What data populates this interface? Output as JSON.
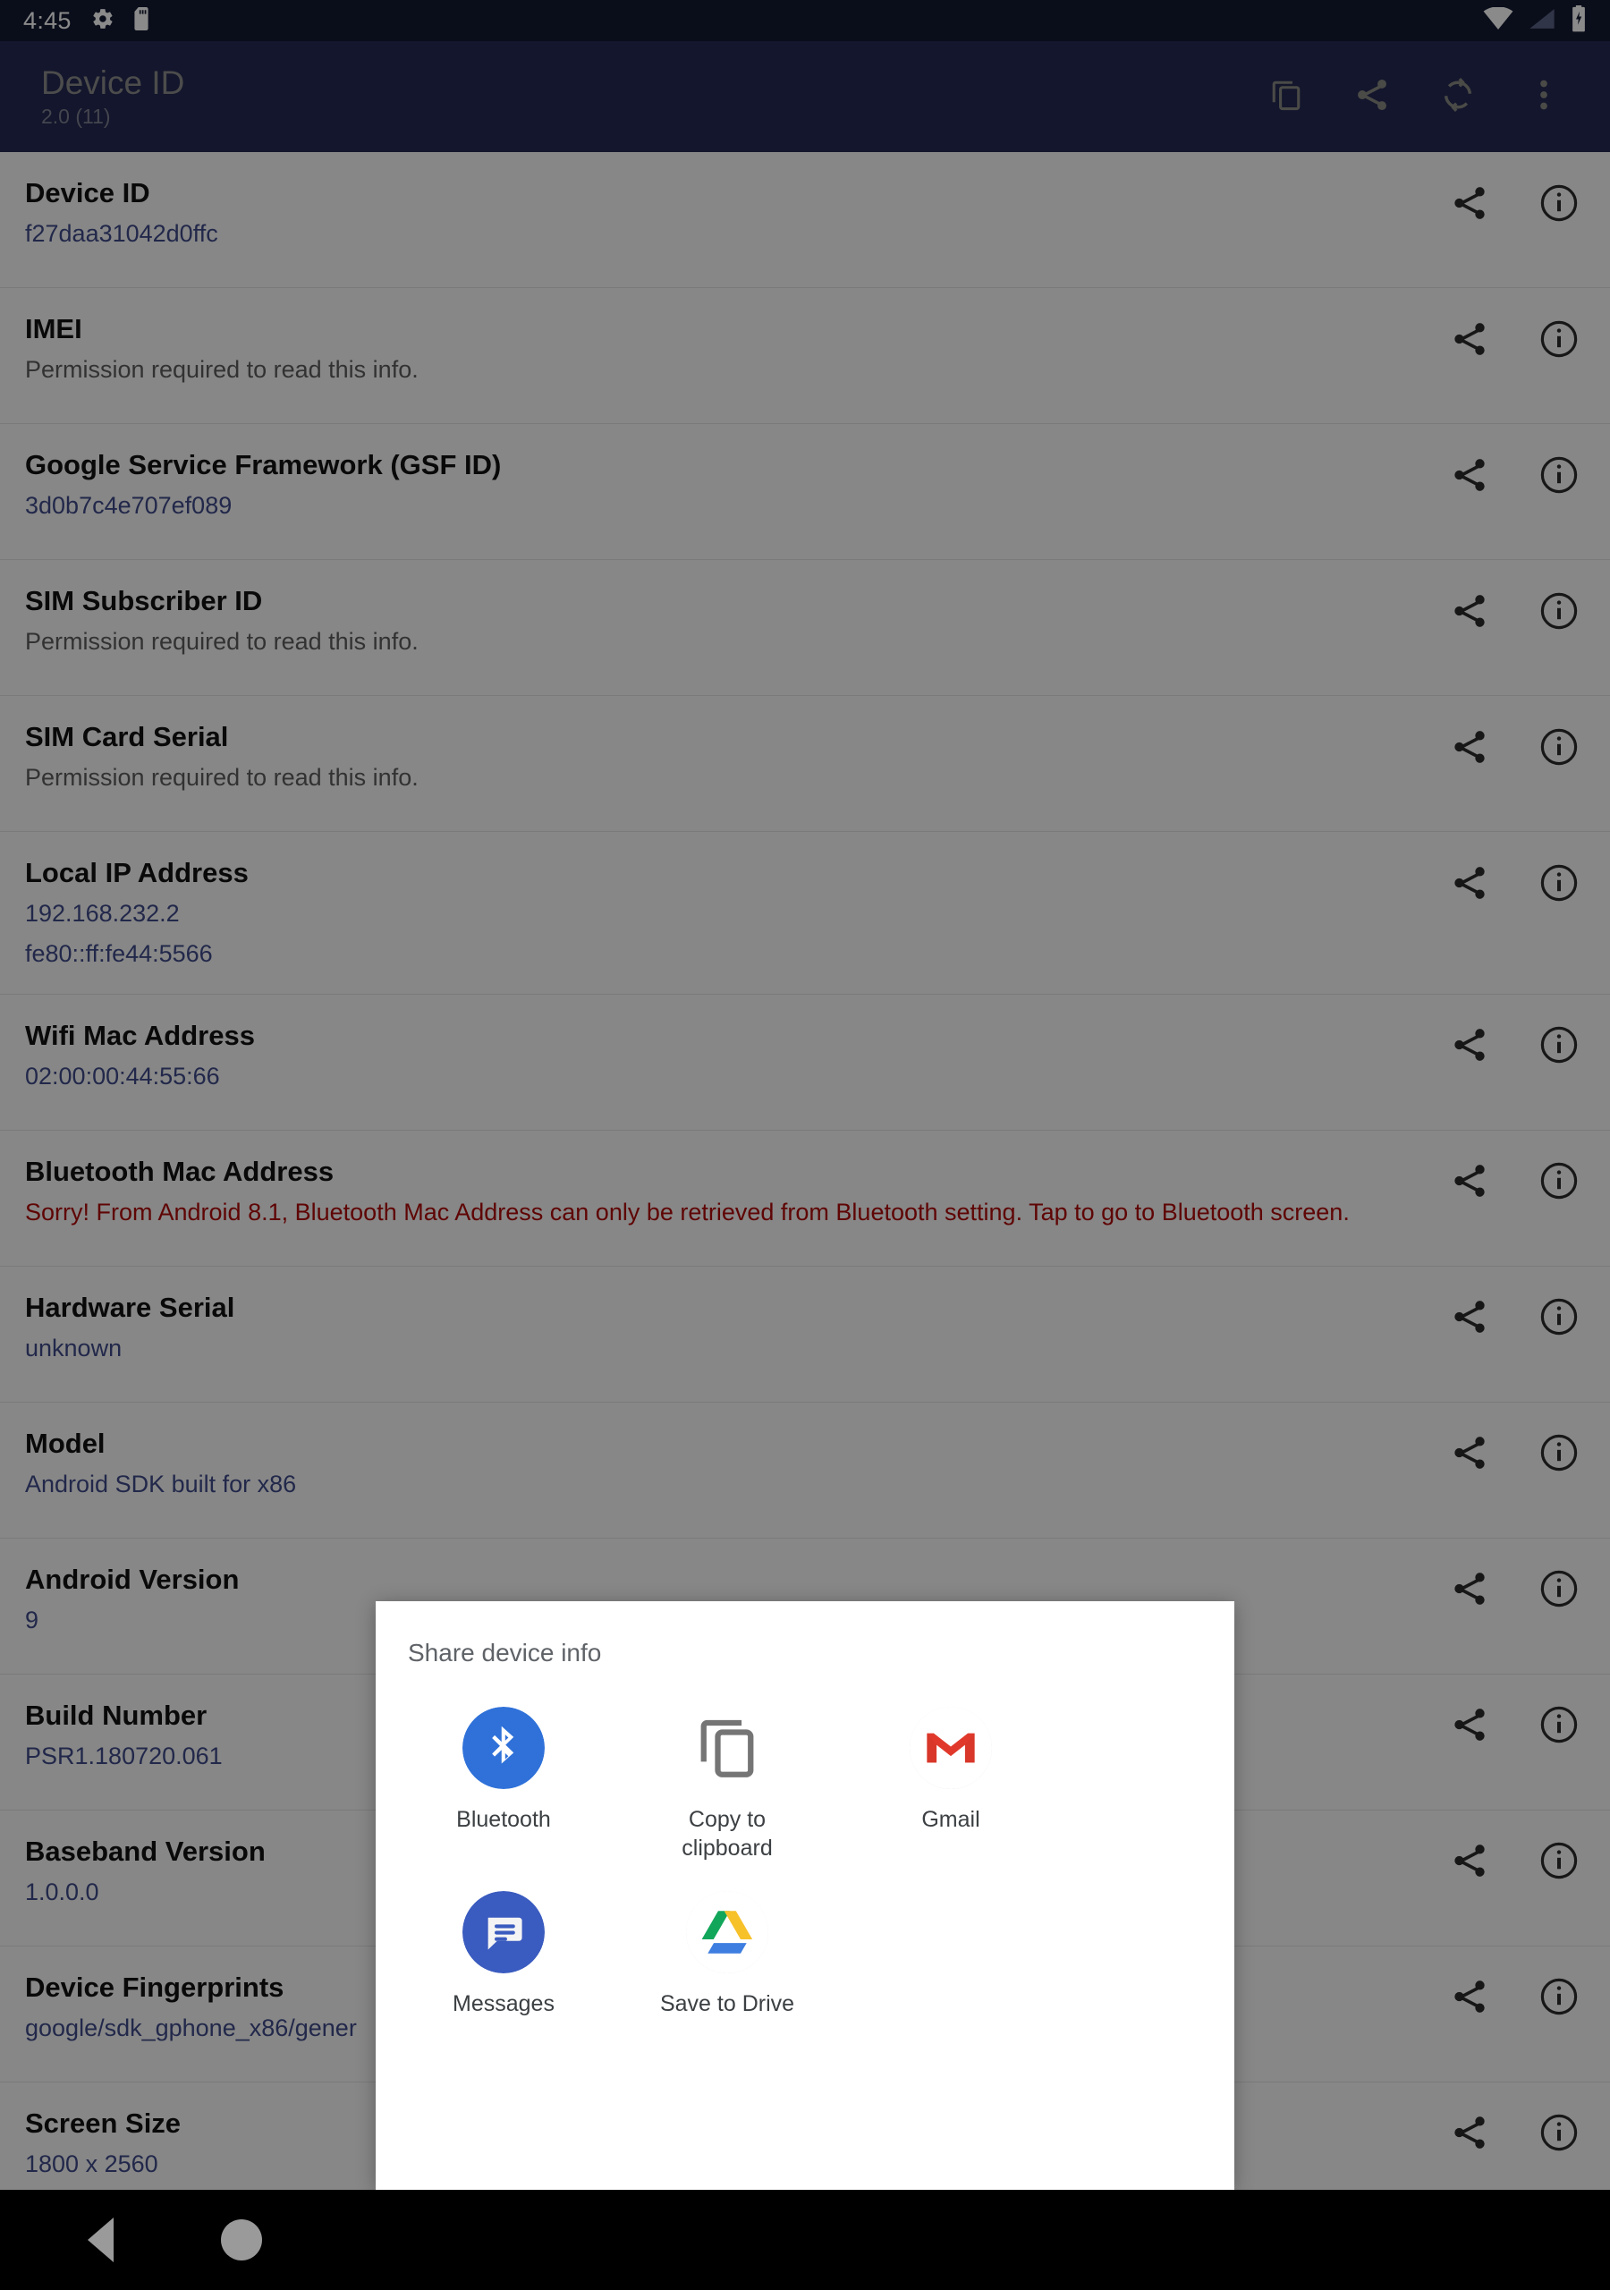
{
  "statusbar": {
    "time": "4:45",
    "icons_left": [
      "gear-icon",
      "sdcard-icon"
    ],
    "icons_right": [
      "wifi-icon",
      "cellular-signal-icon",
      "battery-charging-icon"
    ]
  },
  "appbar": {
    "title": "Device ID",
    "subtitle": "2.0 (11)",
    "actions": [
      {
        "name": "copy-all-icon",
        "label": "Copy all"
      },
      {
        "name": "share-icon",
        "label": "Share"
      },
      {
        "name": "refresh-icon",
        "label": "Refresh"
      },
      {
        "name": "overflow-menu-icon",
        "label": "More options"
      }
    ]
  },
  "list": {
    "row_action_icons": [
      "share-icon",
      "info-icon"
    ],
    "rows": [
      {
        "title": "Device ID",
        "value": "f27daa31042d0ffc",
        "style": "link"
      },
      {
        "title": "IMEI",
        "value": "Permission required to read this info.",
        "style": "muted"
      },
      {
        "title": "Google Service Framework (GSF ID)",
        "value": "3d0b7c4e707ef089",
        "style": "link"
      },
      {
        "title": "SIM Subscriber ID",
        "value": "Permission required to read this info.",
        "style": "muted"
      },
      {
        "title": "SIM Card Serial",
        "value": "Permission required to read this info.",
        "style": "muted"
      },
      {
        "title": "Local IP Address",
        "value": "192.168.232.2",
        "value2": "fe80::ff:fe44:5566",
        "style": "link"
      },
      {
        "title": "Wifi Mac Address",
        "value": "02:00:00:44:55:66",
        "style": "link"
      },
      {
        "title": "Bluetooth Mac Address",
        "value": "Sorry! From Android 8.1, Bluetooth Mac Address can only be retrieved from Bluetooth setting. Tap to go to Bluetooth screen.",
        "style": "danger"
      },
      {
        "title": "Hardware Serial",
        "value": "unknown",
        "style": "link"
      },
      {
        "title": "Model",
        "value": "Android SDK built for x86",
        "style": "link"
      },
      {
        "title": "Android Version",
        "value": "9",
        "style": "link"
      },
      {
        "title": "Build Number",
        "value": "PSR1.180720.061",
        "style": "link"
      },
      {
        "title": "Baseband Version",
        "value": "1.0.0.0",
        "style": "link"
      },
      {
        "title": "Device Fingerprints",
        "value": "google/sdk_gphone_x86/gener",
        "style": "link"
      },
      {
        "title": "Screen Size",
        "value": "1800 x 2560",
        "style": "link"
      }
    ]
  },
  "share_dialog": {
    "title": "Share device info",
    "targets": [
      {
        "label": "Bluetooth",
        "icon": "bluetooth-icon"
      },
      {
        "label": "Copy to clipboard",
        "icon": "copy-to-clipboard-icon"
      },
      {
        "label": "Gmail",
        "icon": "gmail-icon"
      },
      {
        "label": "Messages",
        "icon": "messages-icon"
      },
      {
        "label": "Save to Drive",
        "icon": "google-drive-icon"
      }
    ]
  },
  "navbar": {
    "back_label": "Back",
    "home_label": "Home"
  },
  "colors": {
    "statusbar": "#141a33",
    "appbar": "#232a52",
    "link_value": "#3f4a8a",
    "danger": "#b00a0a",
    "bluetooth_blue": "#2f71d9",
    "messages_blue": "#3a5bbf",
    "gmail_red": "#e0392b",
    "drive_green": "#12a65a",
    "drive_yellow": "#f7c12a",
    "drive_blue": "#3d7ee0"
  }
}
